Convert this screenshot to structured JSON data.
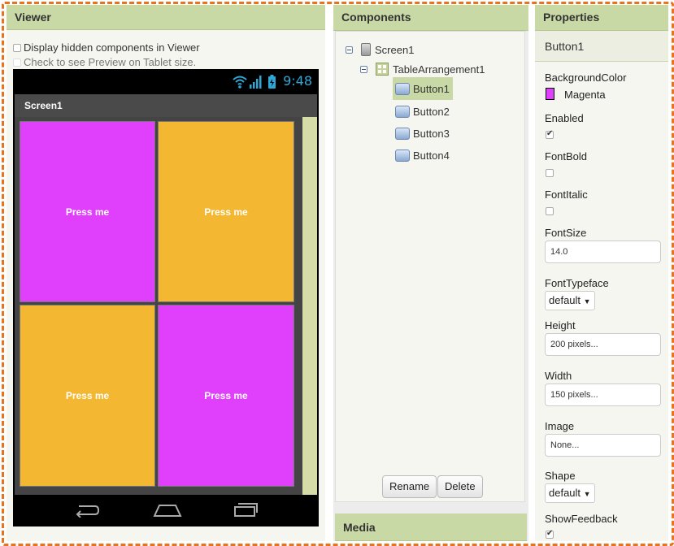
{
  "viewer": {
    "title": "Viewer",
    "option_hidden": "Display hidden components in Viewer",
    "option_tablet": "Check to see Preview on Tablet size.",
    "phone": {
      "status_time": "9:48",
      "screen_title": "Screen1",
      "buttons": [
        {
          "label": "Press me",
          "color": "#e040fb"
        },
        {
          "label": "Press me",
          "color": "#f4b731"
        },
        {
          "label": "Press me",
          "color": "#f4b731"
        },
        {
          "label": "Press me",
          "color": "#e040fb"
        }
      ]
    }
  },
  "components": {
    "title": "Components",
    "tree": {
      "screen": "Screen1",
      "arrangement": "TableArrangement1",
      "buttons": [
        "Button1",
        "Button2",
        "Button3",
        "Button4"
      ],
      "selected": "Button1"
    },
    "rename_label": "Rename",
    "delete_label": "Delete",
    "media_title": "Media"
  },
  "properties": {
    "title": "Properties",
    "component_name": "Button1",
    "background_color_label": "BackgroundColor",
    "background_color_value": "Magenta",
    "background_color_hex": "#e040fb",
    "enabled_label": "Enabled",
    "enabled": true,
    "fontbold_label": "FontBold",
    "fontbold": false,
    "fontitalic_label": "FontItalic",
    "fontitalic": false,
    "fontsize_label": "FontSize",
    "fontsize_value": "14.0",
    "fonttypeface_label": "FontTypeface",
    "fonttypeface_value": "default",
    "height_label": "Height",
    "height_value": "200 pixels...",
    "width_label": "Width",
    "width_value": "150 pixels...",
    "image_label": "Image",
    "image_value": "None...",
    "shape_label": "Shape",
    "shape_value": "default",
    "showfeedback_label": "ShowFeedback",
    "showfeedback": true
  },
  "accent_color": "#e8731e",
  "header_color": "#c9d9a6"
}
